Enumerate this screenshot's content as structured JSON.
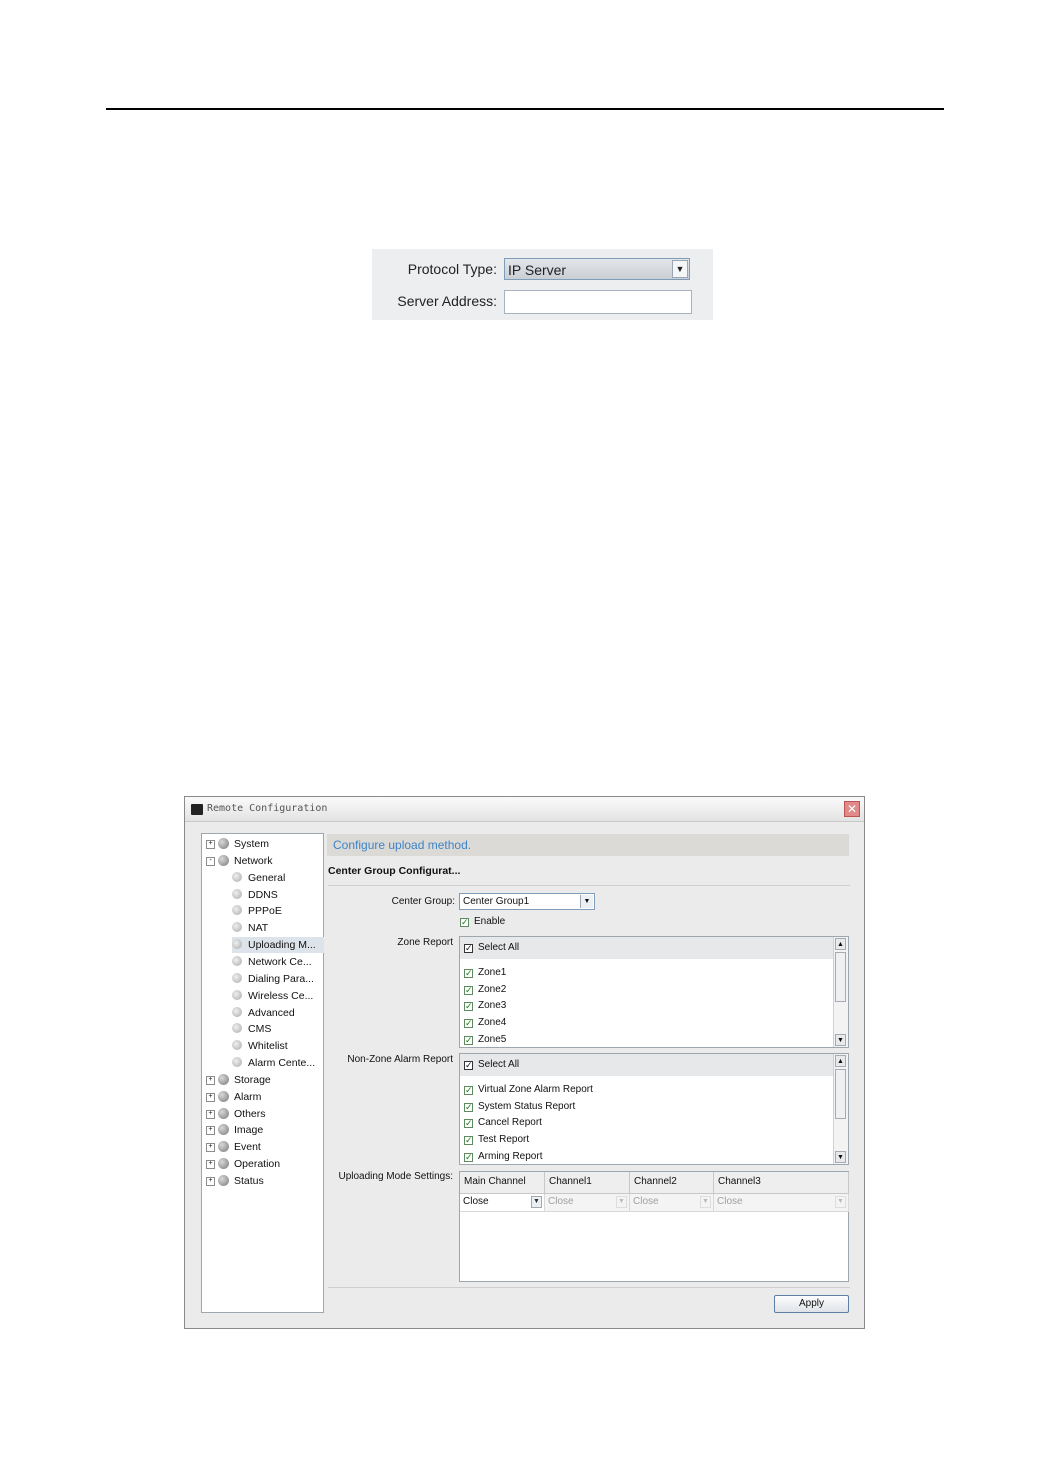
{
  "protocol_panel": {
    "protocol_type_label": "Protocol Type:",
    "protocol_type_value": "IP Server",
    "server_address_label": "Server Address:",
    "server_address_value": ""
  },
  "window": {
    "title": "Remote Configuration",
    "tree": [
      {
        "label": "System",
        "expander": "+"
      },
      {
        "label": "Network",
        "expander": "-"
      },
      {
        "label": "General"
      },
      {
        "label": "DDNS"
      },
      {
        "label": "PPPoE"
      },
      {
        "label": "NAT"
      },
      {
        "label": "Uploading M...",
        "selected": true
      },
      {
        "label": "Network Ce..."
      },
      {
        "label": "Dialing Para..."
      },
      {
        "label": "Wireless Ce..."
      },
      {
        "label": "Advanced"
      },
      {
        "label": "CMS"
      },
      {
        "label": "Whitelist"
      },
      {
        "label": "Alarm Cente..."
      },
      {
        "label": "Storage",
        "expander": "+"
      },
      {
        "label": "Alarm",
        "expander": "+"
      },
      {
        "label": "Others",
        "expander": "+"
      },
      {
        "label": "Image",
        "expander": "+"
      },
      {
        "label": "Event",
        "expander": "+"
      },
      {
        "label": "Operation",
        "expander": "+"
      },
      {
        "label": "Status",
        "expander": "+"
      }
    ],
    "banner": "Configure upload method.",
    "section_title": "Center Group Configurat...",
    "center_group_label": "Center Group:",
    "center_group_value": "Center Group1",
    "enable_label": "Enable",
    "enable_checked": true,
    "zone_report_label": "Zone Report",
    "zone_report_items": [
      "Select All",
      "Zone1",
      "Zone2",
      "Zone3",
      "Zone4",
      "Zone5"
    ],
    "non_zone_label": "Non-Zone Alarm Report",
    "non_zone_items": [
      "Select All",
      "Virtual Zone Alarm Report",
      "System Status Report",
      "Cancel Report",
      "Test Report",
      "Arming Report"
    ],
    "uploading_mode_label": "Uploading Mode Settings:",
    "channel_headers": [
      "Main Channel",
      "Channel1",
      "Channel2",
      "Channel3"
    ],
    "channel_values": [
      "Close",
      "Close",
      "Close",
      "Close"
    ],
    "apply_label": "Apply",
    "colors": {
      "banner_text": "#3d84c6",
      "check": "#1a7a1a"
    }
  }
}
